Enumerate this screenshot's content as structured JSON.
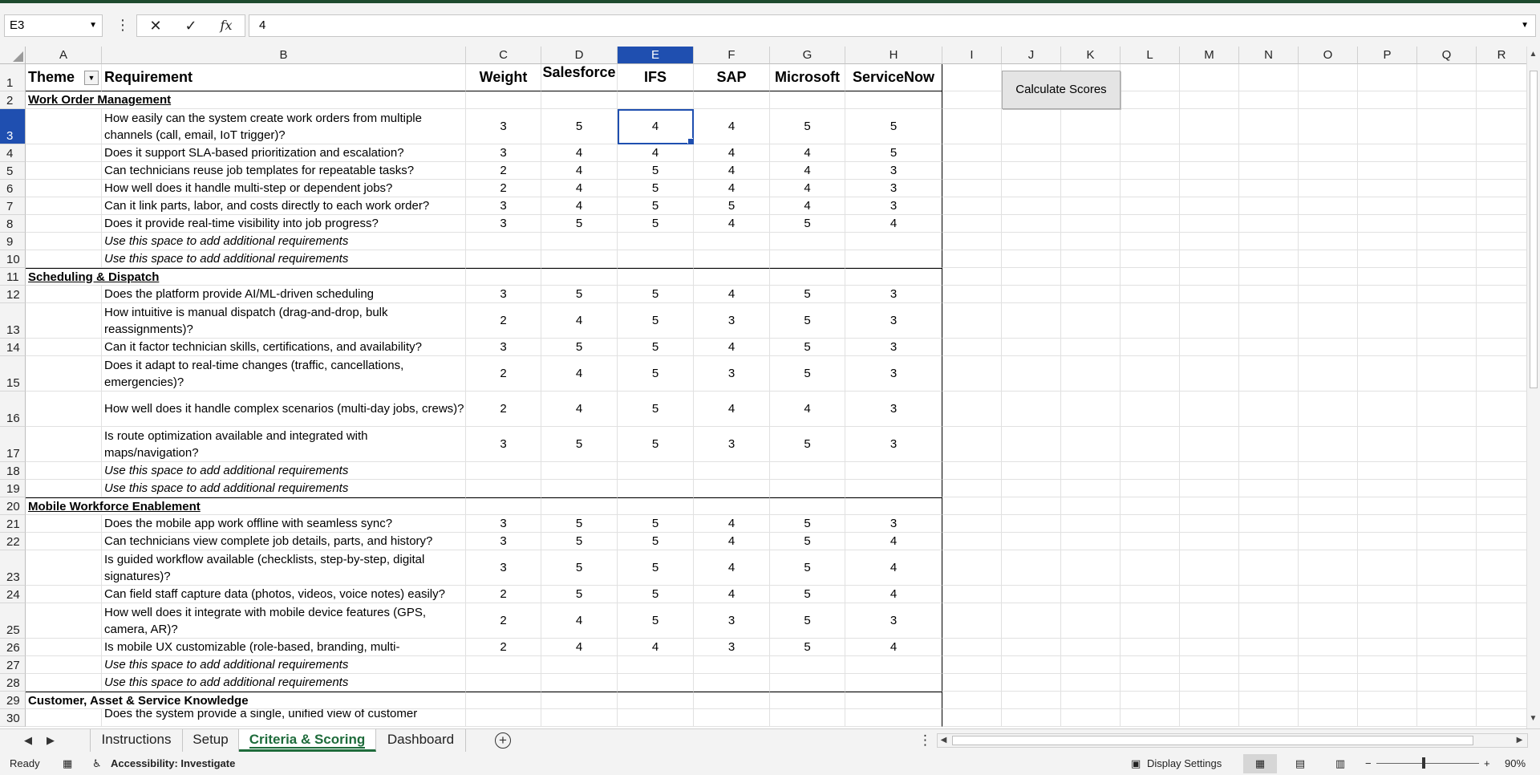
{
  "formula_bar": {
    "name_box": "E3",
    "cancel_symbol": "✕",
    "enter_symbol": "✓",
    "function_symbol": "fx",
    "formula_value": "4"
  },
  "columns": [
    "A",
    "B",
    "C",
    "D",
    "E",
    "F",
    "G",
    "H",
    "I",
    "J",
    "K",
    "L",
    "M",
    "N",
    "O",
    "P",
    "Q",
    "R"
  ],
  "selected_column": "E",
  "header_row": {
    "theme": "Theme",
    "requirement": "Requirement",
    "weight": "Weight",
    "vendors": [
      "Salesforce",
      "IFS",
      "SAP",
      "Microsoft",
      "ServiceNow"
    ]
  },
  "rows": [
    {
      "n": "1",
      "type": "header"
    },
    {
      "n": "2",
      "type": "section",
      "label": "Work Order Management",
      "underline": true
    },
    {
      "n": "3",
      "type": "req",
      "text": "How easily can the system create work orders from multiple channels (call, email, IoT trigger)?",
      "weight": "3",
      "scores": [
        "5",
        "4",
        "4",
        "5",
        "5"
      ]
    },
    {
      "n": "4",
      "type": "req",
      "text": "Does it support SLA-based prioritization and escalation?",
      "weight": "3",
      "scores": [
        "4",
        "4",
        "4",
        "4",
        "5"
      ]
    },
    {
      "n": "5",
      "type": "req",
      "text": "Can technicians reuse job templates for repeatable tasks?",
      "weight": "2",
      "scores": [
        "4",
        "5",
        "4",
        "4",
        "3"
      ]
    },
    {
      "n": "6",
      "type": "req",
      "text": "How well does it handle multi-step or dependent jobs?",
      "weight": "2",
      "scores": [
        "4",
        "5",
        "4",
        "4",
        "3"
      ]
    },
    {
      "n": "7",
      "type": "req",
      "text": "Can it link parts, labor, and costs directly to each work order?",
      "weight": "3",
      "scores": [
        "4",
        "5",
        "5",
        "4",
        "3"
      ]
    },
    {
      "n": "8",
      "type": "req",
      "text": "Does it provide real-time visibility into job progress?",
      "weight": "3",
      "scores": [
        "5",
        "5",
        "4",
        "5",
        "4"
      ]
    },
    {
      "n": "9",
      "type": "placeholder",
      "text": "Use this space to add additional requirements"
    },
    {
      "n": "10",
      "type": "placeholder",
      "text": "Use this space to add additional requirements"
    },
    {
      "n": "11",
      "type": "section",
      "label": "Scheduling & Dispatch",
      "underline": true
    },
    {
      "n": "12",
      "type": "req",
      "text": "Does the platform provide AI/ML-driven scheduling",
      "weight": "3",
      "scores": [
        "5",
        "5",
        "4",
        "5",
        "3"
      ]
    },
    {
      "n": "13",
      "type": "req",
      "text": "How intuitive is manual dispatch (drag-and-drop, bulk reassignments)?",
      "weight": "2",
      "scores": [
        "4",
        "5",
        "3",
        "5",
        "3"
      ]
    },
    {
      "n": "14",
      "type": "req",
      "text": "Can it factor technician skills, certifications, and availability?",
      "weight": "3",
      "scores": [
        "5",
        "5",
        "4",
        "5",
        "3"
      ]
    },
    {
      "n": "15",
      "type": "req",
      "text": "Does it adapt to real-time changes (traffic, cancellations, emergencies)?",
      "weight": "2",
      "scores": [
        "4",
        "5",
        "3",
        "5",
        "3"
      ]
    },
    {
      "n": "16",
      "type": "req",
      "text": "How well does it handle complex scenarios (multi-day jobs, crews)?",
      "weight": "2",
      "scores": [
        "4",
        "5",
        "4",
        "4",
        "3"
      ]
    },
    {
      "n": "17",
      "type": "req",
      "text": "Is route optimization available and integrated with maps/navigation?",
      "weight": "3",
      "scores": [
        "5",
        "5",
        "3",
        "5",
        "3"
      ]
    },
    {
      "n": "18",
      "type": "placeholder",
      "text": "Use this space to add additional requirements"
    },
    {
      "n": "19",
      "type": "placeholder",
      "text": "Use this space to add additional requirements"
    },
    {
      "n": "20",
      "type": "section",
      "label": "Mobile Workforce Enablement",
      "underline": true
    },
    {
      "n": "21",
      "type": "req",
      "text": "Does the mobile app work offline with seamless sync?",
      "weight": "3",
      "scores": [
        "5",
        "5",
        "4",
        "5",
        "3"
      ]
    },
    {
      "n": "22",
      "type": "req",
      "text": "Can technicians view complete job details, parts, and history?",
      "weight": "3",
      "scores": [
        "5",
        "5",
        "4",
        "5",
        "4"
      ]
    },
    {
      "n": "23",
      "type": "req",
      "text": "Is guided workflow available (checklists, step-by-step, digital signatures)?",
      "weight": "3",
      "scores": [
        "5",
        "5",
        "4",
        "5",
        "4"
      ]
    },
    {
      "n": "24",
      "type": "req",
      "text": "Can field staff capture data (photos, videos, voice notes) easily?",
      "weight": "2",
      "scores": [
        "5",
        "5",
        "4",
        "5",
        "4"
      ]
    },
    {
      "n": "25",
      "type": "req",
      "text": "How well does it integrate with mobile device features (GPS, camera, AR)?",
      "weight": "2",
      "scores": [
        "4",
        "5",
        "3",
        "5",
        "3"
      ]
    },
    {
      "n": "26",
      "type": "req",
      "text": "Is mobile UX customizable (role-based, branding, multi-",
      "weight": "2",
      "scores": [
        "4",
        "4",
        "3",
        "5",
        "4"
      ]
    },
    {
      "n": "27",
      "type": "placeholder",
      "text": "Use this space to add additional requirements"
    },
    {
      "n": "28",
      "type": "placeholder",
      "text": "Use this space to add additional requirements"
    },
    {
      "n": "29",
      "type": "section",
      "label": "Customer, Asset & Service Knowledge",
      "underline": false
    },
    {
      "n": "30",
      "type": "partial",
      "text": "Does the system provide a single, unified view of customer"
    }
  ],
  "calculate_button": "Calculate Scores",
  "sheet_tabs": [
    "Instructions",
    "Setup",
    "Criteria & Scoring",
    "Dashboard"
  ],
  "active_tab": "Criteria & Scoring",
  "status_bar": {
    "ready": "Ready",
    "accessibility": "Accessibility: Investigate",
    "display_settings": "Display Settings",
    "zoom": "90%",
    "zoom_minus": "−",
    "zoom_plus": "+"
  }
}
